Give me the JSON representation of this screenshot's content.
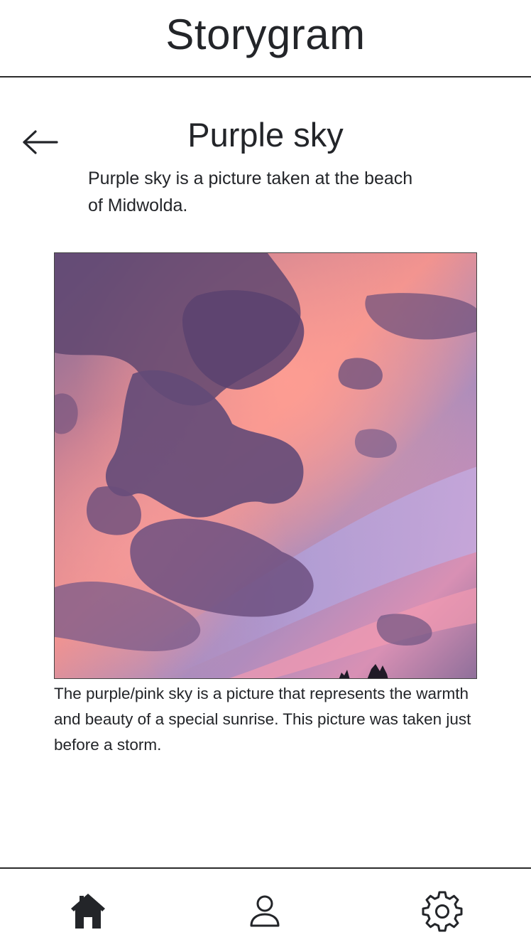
{
  "header": {
    "app_title": "Storygram"
  },
  "post": {
    "title": "Purple sky",
    "intro": "Purple sky is a picture taken at the beach of Midwolda.",
    "caption": "The purple/pink sky is a picture that represents the warmth and beauty of a special sunrise. This picture was taken just before a storm."
  },
  "icons": {
    "back": "arrow-left-icon",
    "home": "home-icon",
    "profile": "user-icon",
    "settings": "gear-icon"
  },
  "colors": {
    "text": "#232529",
    "divider": "#2b2b2b",
    "sky_pink": "#f0928f",
    "sky_purple": "#8a78a8",
    "cloud": "#6e4f78"
  }
}
